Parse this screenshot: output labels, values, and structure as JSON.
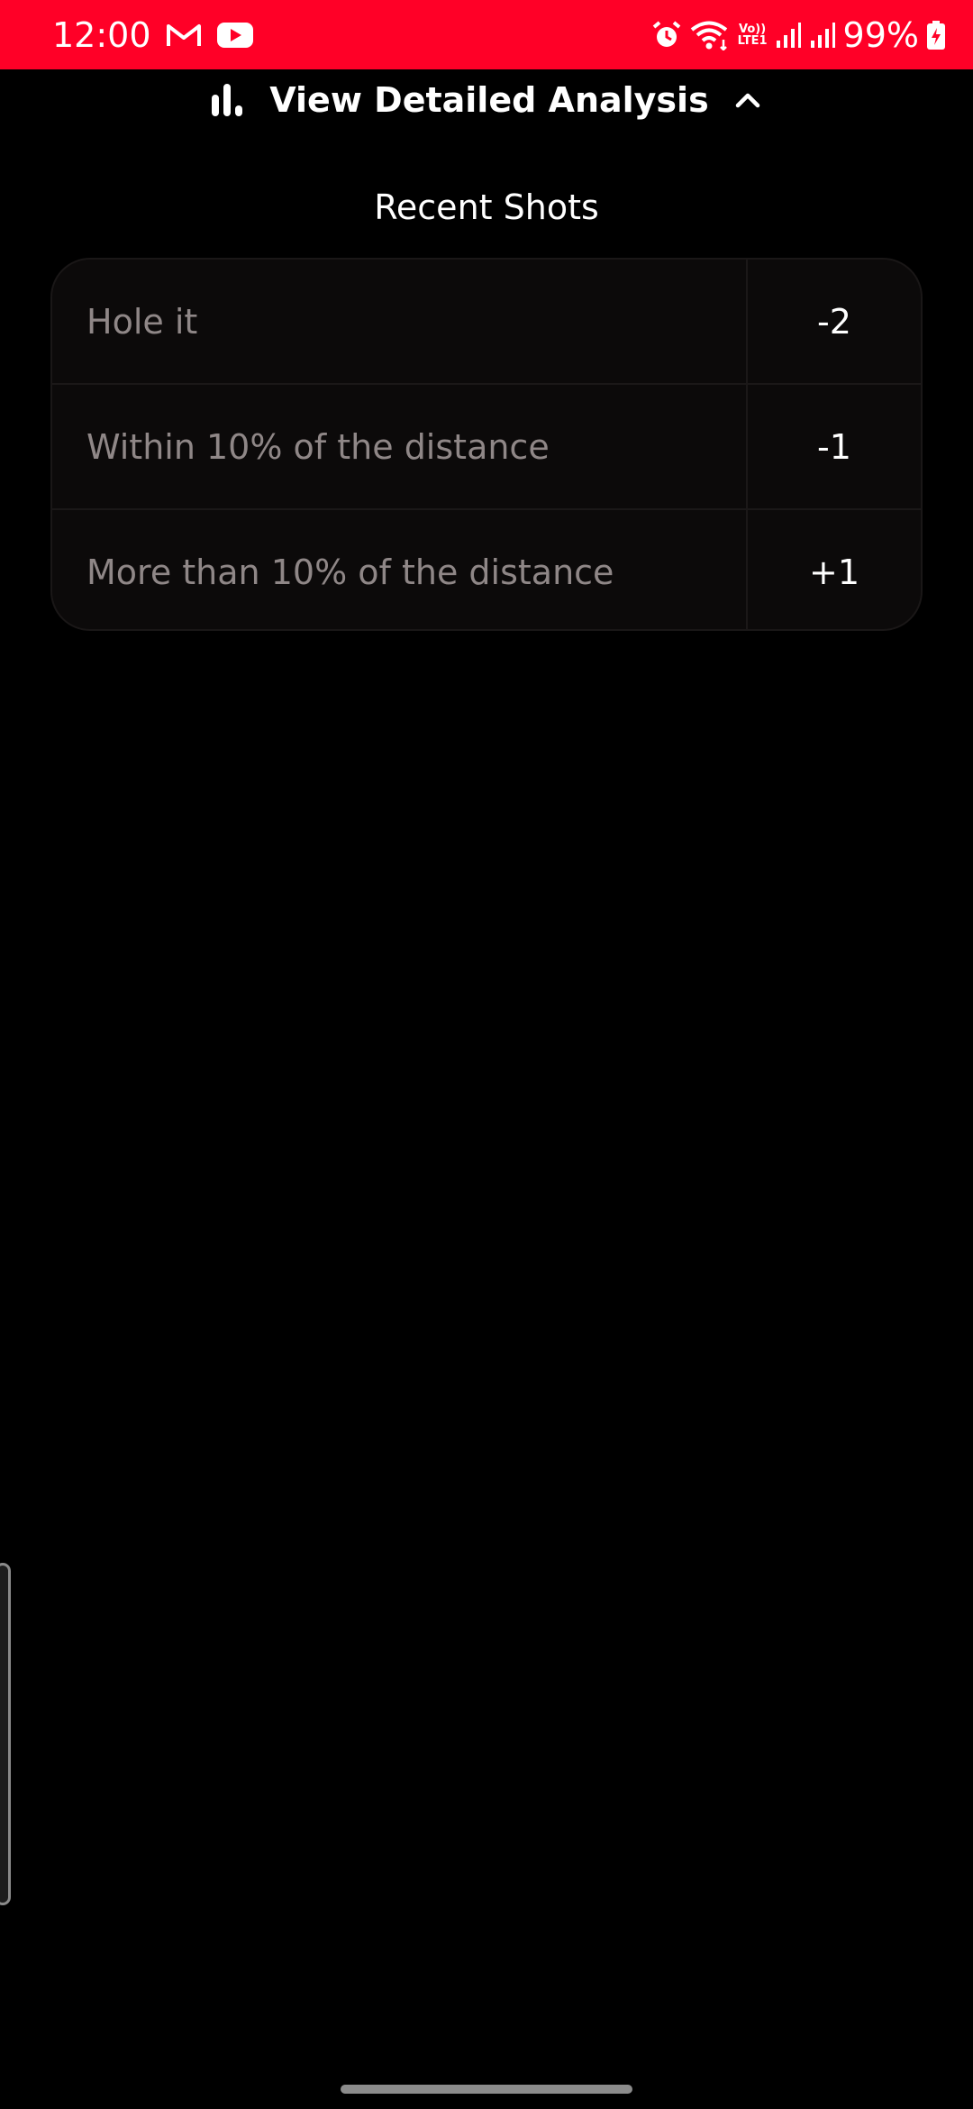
{
  "status_bar": {
    "time": "12:00",
    "battery_percent": "99%",
    "volte_top": "Vo))",
    "volte_bottom": "LTE1",
    "icons": [
      "gmail-icon",
      "youtube-icon",
      "alarm-icon",
      "wifi-icon",
      "volte-icon",
      "signal-icon",
      "signal-icon",
      "battery-charging-icon"
    ],
    "background_color": "#ff0027"
  },
  "analysis_toggle": {
    "label": "View Detailed Analysis",
    "icon": "bar-chart-icon",
    "expand_icon": "chevron-up-icon",
    "expanded": true
  },
  "recent_shots": {
    "title": "Recent Shots",
    "rows": [
      {
        "label": "Hole it",
        "value": "-2"
      },
      {
        "label": "Within 10% of the distance",
        "value": "-1"
      },
      {
        "label": "More than 10% of the distance",
        "value": "+1"
      }
    ]
  },
  "colors": {
    "background": "#000000",
    "card": "#0c0a0a",
    "muted_text": "#8f8787",
    "text": "#ffffff"
  }
}
